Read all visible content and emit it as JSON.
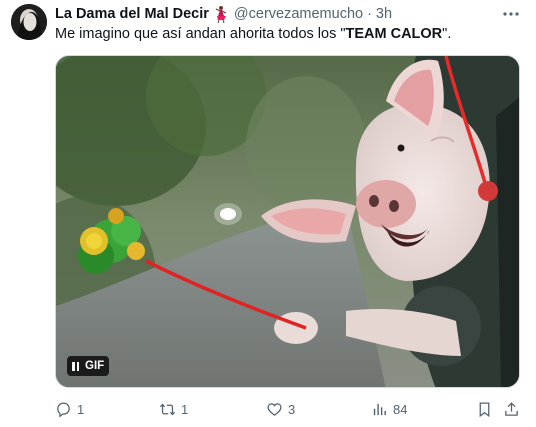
{
  "author": {
    "display_name": "La Dama del Mal Decir",
    "handle": "@cervezamemucho",
    "separator": "·",
    "timestamp": "3h"
  },
  "tweet": {
    "text_before": "Me imagino que así andan ahorita todos los \"",
    "text_bold": "TEAM CALOR",
    "text_after": "\"."
  },
  "media": {
    "badge_label": "GIF"
  },
  "actions": {
    "replies": "1",
    "reposts": "1",
    "likes": "3",
    "views": "84"
  },
  "icons": {
    "more": "more-icon",
    "reply": "reply-icon",
    "repost": "repost-icon",
    "like": "heart-icon",
    "views": "views-icon",
    "bookmark": "bookmark-icon",
    "share": "share-icon",
    "emoji": "dancer-emoji-icon"
  }
}
